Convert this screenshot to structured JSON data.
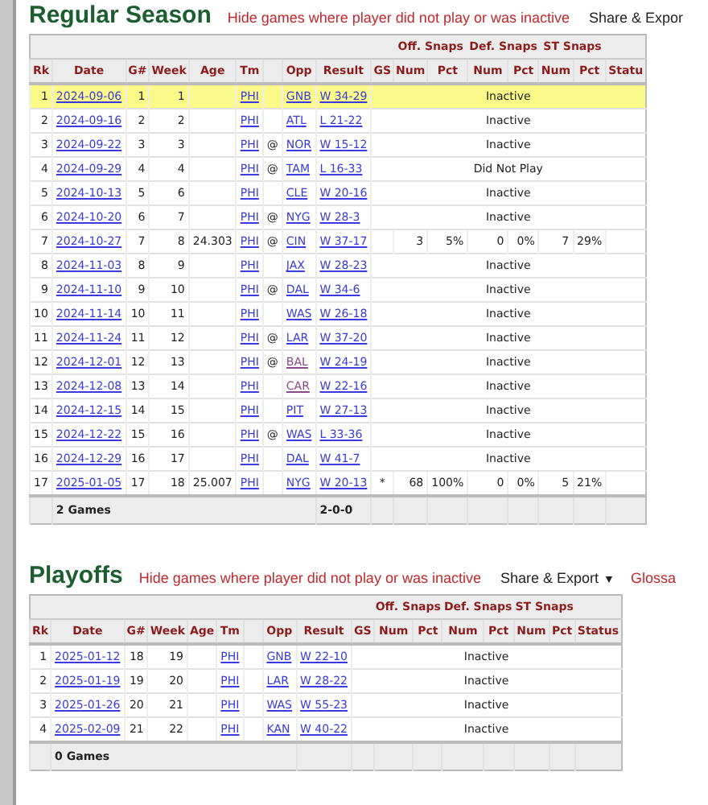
{
  "sections": [
    {
      "title": "Regular Season",
      "filter_link": "Hide games where player did not play or was inactive",
      "share_menu": {
        "label": "Share & Expor"
      },
      "table": {
        "group_headers": [
          "Off. Snaps",
          "Def. Snaps",
          "ST Snaps"
        ],
        "columns": [
          {
            "label": "Rk"
          },
          {
            "label": "Date"
          },
          {
            "label": "G#"
          },
          {
            "label": "Week"
          },
          {
            "label": "Age"
          },
          {
            "label": "Tm"
          },
          {
            "kind": "spacer"
          },
          {
            "label": "Opp"
          },
          {
            "label": "Result"
          },
          {
            "label": "GS"
          },
          {
            "label": "Num"
          },
          {
            "label": "Pct"
          },
          {
            "label": "Num"
          },
          {
            "label": "Pct"
          },
          {
            "label": "Num"
          },
          {
            "label": "Pct"
          },
          {
            "label": "Statu"
          }
        ],
        "rows": [
          {
            "kind": "status",
            "rk": "1",
            "date": "2024-09-06",
            "game": "1",
            "week": "1",
            "team": "PHI",
            "opp": "GNB",
            "opp_visited": false,
            "result": "W 34-29",
            "highlighted": true,
            "status": "Inactive"
          },
          {
            "kind": "status",
            "rk": "2",
            "date": "2024-09-16",
            "game": "2",
            "week": "2",
            "team": "PHI",
            "opp": "ATL",
            "opp_visited": false,
            "result": "L 21-22",
            "highlighted": false,
            "status": "Inactive"
          },
          {
            "kind": "status",
            "rk": "3",
            "date": "2024-09-22",
            "game": "3",
            "week": "3",
            "team": "PHI",
            "venue": "@",
            "opp": "NOR",
            "opp_visited": false,
            "result": "W 15-12",
            "highlighted": false,
            "status": "Inactive"
          },
          {
            "kind": "status",
            "rk": "4",
            "date": "2024-09-29",
            "game": "4",
            "week": "4",
            "team": "PHI",
            "venue": "@",
            "opp": "TAM",
            "opp_visited": false,
            "result": "L 16-33",
            "highlighted": false,
            "status": "Did Not Play"
          },
          {
            "kind": "status",
            "rk": "5",
            "date": "2024-10-13",
            "game": "5",
            "week": "6",
            "team": "PHI",
            "opp": "CLE",
            "opp_visited": false,
            "result": "W 20-16",
            "highlighted": false,
            "status": "Inactive"
          },
          {
            "kind": "status",
            "rk": "6",
            "date": "2024-10-20",
            "game": "6",
            "week": "7",
            "team": "PHI",
            "venue": "@",
            "opp": "NYG",
            "opp_visited": false,
            "result": "W 28-3",
            "highlighted": false,
            "status": "Inactive"
          },
          {
            "kind": "stats",
            "rk": "7",
            "date": "2024-10-27",
            "game": "7",
            "week": "8",
            "age": "24.303",
            "team": "PHI",
            "venue": "@",
            "opp": "CIN",
            "opp_visited": false,
            "result": "W 37-17",
            "highlighted": false,
            "stats": [
              "3",
              "5%",
              "0",
              "0%",
              "7",
              "29%"
            ]
          },
          {
            "kind": "status",
            "rk": "8",
            "date": "2024-11-03",
            "game": "8",
            "week": "9",
            "team": "PHI",
            "opp": "JAX",
            "opp_visited": false,
            "result": "W 28-23",
            "highlighted": false,
            "status": "Inactive"
          },
          {
            "kind": "status",
            "rk": "9",
            "date": "2024-11-10",
            "game": "9",
            "week": "10",
            "team": "PHI",
            "venue": "@",
            "opp": "DAL",
            "opp_visited": false,
            "result": "W 34-6",
            "highlighted": false,
            "status": "Inactive"
          },
          {
            "kind": "status",
            "rk": "10",
            "date": "2024-11-14",
            "game": "10",
            "week": "11",
            "team": "PHI",
            "opp": "WAS",
            "opp_visited": false,
            "result": "W 26-18",
            "highlighted": false,
            "status": "Inactive"
          },
          {
            "kind": "status",
            "rk": "11",
            "date": "2024-11-24",
            "game": "11",
            "week": "12",
            "team": "PHI",
            "venue": "@",
            "opp": "LAR",
            "opp_visited": false,
            "result": "W 37-20",
            "highlighted": false,
            "status": "Inactive"
          },
          {
            "kind": "status",
            "rk": "12",
            "date": "2024-12-01",
            "game": "12",
            "week": "13",
            "team": "PHI",
            "venue": "@",
            "opp": "BAL",
            "opp_visited": true,
            "result": "W 24-19",
            "highlighted": false,
            "status": "Inactive"
          },
          {
            "kind": "status",
            "rk": "13",
            "date": "2024-12-08",
            "game": "13",
            "week": "14",
            "team": "PHI",
            "opp": "CAR",
            "opp_visited": true,
            "result": "W 22-16",
            "highlighted": false,
            "status": "Inactive"
          },
          {
            "kind": "status",
            "rk": "14",
            "date": "2024-12-15",
            "game": "14",
            "week": "15",
            "team": "PHI",
            "opp": "PIT",
            "opp_visited": false,
            "result": "W 27-13",
            "highlighted": false,
            "status": "Inactive"
          },
          {
            "kind": "status",
            "rk": "15",
            "date": "2024-12-22",
            "game": "15",
            "week": "16",
            "team": "PHI",
            "venue": "@",
            "opp": "WAS",
            "opp_visited": false,
            "result": "L 33-36",
            "highlighted": false,
            "status": "Inactive"
          },
          {
            "kind": "status",
            "rk": "16",
            "date": "2024-12-29",
            "game": "16",
            "week": "17",
            "team": "PHI",
            "opp": "DAL",
            "opp_visited": false,
            "result": "W 41-7",
            "highlighted": false,
            "status": "Inactive"
          },
          {
            "kind": "stats",
            "rk": "17",
            "date": "2025-01-05",
            "game": "17",
            "week": "18",
            "age": "25.007",
            "team": "PHI",
            "opp": "NYG",
            "opp_visited": false,
            "result": "W 20-13",
            "highlighted": false,
            "gs": "*",
            "stats": [
              "68",
              "100%",
              "0",
              "0%",
              "5",
              "21%"
            ]
          }
        ],
        "footer": {
          "label": "2 Games",
          "result": "2-0-0"
        }
      }
    },
    {
      "title": "Playoffs",
      "filter_link": "Hide games where player did not play or was inactive",
      "share_menu": {
        "label": "Share & Export",
        "caret": "▼"
      },
      "glossary_link": "Glossa",
      "table": {
        "group_headers": [
          "Off. Snaps",
          "Def. Snaps",
          "ST Snaps"
        ],
        "columns": [
          {
            "label": "Rk"
          },
          {
            "label": "Date"
          },
          {
            "label": "G#"
          },
          {
            "label": "Week"
          },
          {
            "label": "Age"
          },
          {
            "label": "Tm"
          },
          {
            "kind": "spacer"
          },
          {
            "label": "Opp"
          },
          {
            "label": "Result"
          },
          {
            "label": "GS"
          },
          {
            "label": "Num"
          },
          {
            "label": "Pct"
          },
          {
            "label": "Num"
          },
          {
            "label": "Pct"
          },
          {
            "label": "Num"
          },
          {
            "label": "Pct"
          },
          {
            "label": "Status"
          }
        ],
        "rows": [
          {
            "kind": "status",
            "rk": "1",
            "date": "2025-01-12",
            "game": "18",
            "week": "19",
            "team": "PHI",
            "opp": "GNB",
            "opp_visited": false,
            "result": "W 22-10",
            "highlighted": false,
            "status": "Inactive"
          },
          {
            "kind": "status",
            "rk": "2",
            "date": "2025-01-19",
            "game": "19",
            "week": "20",
            "team": "PHI",
            "opp": "LAR",
            "opp_visited": false,
            "result": "W 28-22",
            "highlighted": false,
            "status": "Inactive"
          },
          {
            "kind": "status",
            "rk": "3",
            "date": "2025-01-26",
            "game": "20",
            "week": "21",
            "team": "PHI",
            "opp": "WAS",
            "opp_visited": false,
            "result": "W 55-23",
            "highlighted": false,
            "status": "Inactive"
          },
          {
            "kind": "status",
            "rk": "4",
            "date": "2025-02-09",
            "game": "21",
            "week": "22",
            "team": "PHI",
            "opp": "KAN",
            "opp_visited": false,
            "result": "W 40-22",
            "highlighted": false,
            "status": "Inactive"
          }
        ],
        "footer": {
          "label": "0 Games"
        }
      }
    }
  ]
}
